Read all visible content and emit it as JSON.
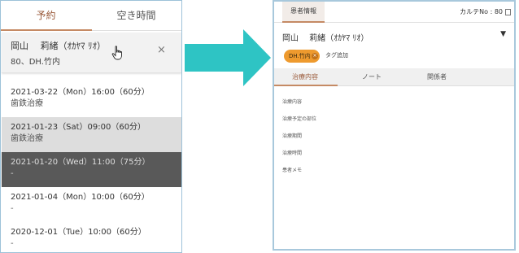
{
  "left": {
    "tabs": {
      "reservation": "予約",
      "free_time": "空き時間"
    },
    "patient": {
      "name": "岡山　 莉緒（ｵｶﾔﾏ ﾘｵ）",
      "sub": "80、DH.竹内",
      "close": "×"
    },
    "appointments": [
      {
        "when": "2021-03-22（Mon）16:00（60分）",
        "what": "歯鉄治療"
      },
      {
        "when": "2021-01-23（Sat）09:00（60分）",
        "what": "歯鉄治療"
      },
      {
        "when": "2021-01-20（Wed）11:00（75分）",
        "what": "-"
      },
      {
        "when": "2021-01-04（Mon）10:00（60分）",
        "what": "-"
      },
      {
        "when": "2020-12-01（Tue）10:00（60分）",
        "what": "-"
      }
    ]
  },
  "right": {
    "tab_patient": "患者情報",
    "karte": "カルテNo : 80",
    "name": "岡山　 莉緒（ｵｶﾔﾏ ﾘｵ）",
    "tag": "DH.竹内",
    "tag_add": "タグ追加",
    "tabs": {
      "treatment": "治療内容",
      "note": "ノート",
      "related": "関係者"
    },
    "fields": [
      "治療内容",
      "治療予定の部位",
      "治療期間",
      "治療時間",
      "患者メモ"
    ]
  },
  "colors": {
    "accent": "#c58a64",
    "arrow": "#2ec4c4",
    "tag": "#ee9a2e",
    "selected_dark": "#595959",
    "selected_light": "#dddddd"
  }
}
